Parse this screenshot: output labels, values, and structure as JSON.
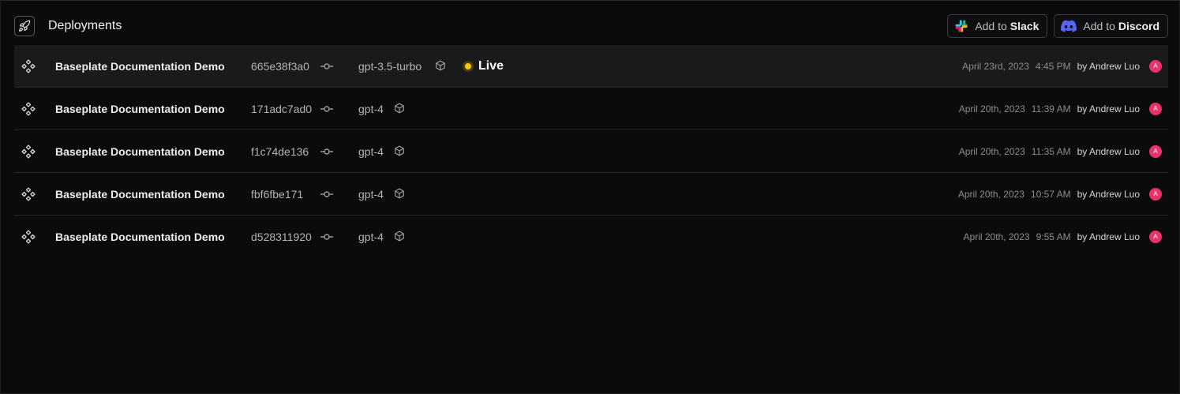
{
  "header": {
    "title": "Deployments",
    "slack_prefix": "Add to",
    "slack_name": "Slack",
    "discord_prefix": "Add to",
    "discord_name": "Discord"
  },
  "colors": {
    "background": "#0b0b0c",
    "row_highlight": "#1a1a1c",
    "live_dot": "#f5c518",
    "avatar": "#e6336b",
    "discord": "#5865f2"
  },
  "deployments": [
    {
      "name": "Baseplate Documentation Demo",
      "hash": "665e38f3a0",
      "model": "gpt-3.5-turbo",
      "status": "Live",
      "date": "April 23rd, 2023",
      "time": "4:45 PM",
      "author": "by Andrew Luo",
      "avatar_initial": "A"
    },
    {
      "name": "Baseplate Documentation Demo",
      "hash": "171adc7ad0",
      "model": "gpt-4",
      "status": "",
      "date": "April 20th, 2023",
      "time": "11:39 AM",
      "author": "by Andrew Luo",
      "avatar_initial": "A"
    },
    {
      "name": "Baseplate Documentation Demo",
      "hash": "f1c74de136",
      "model": "gpt-4",
      "status": "",
      "date": "April 20th, 2023",
      "time": "11:35 AM",
      "author": "by Andrew Luo",
      "avatar_initial": "A"
    },
    {
      "name": "Baseplate Documentation Demo",
      "hash": "fbf6fbe171",
      "model": "gpt-4",
      "status": "",
      "date": "April 20th, 2023",
      "time": "10:57 AM",
      "author": "by Andrew Luo",
      "avatar_initial": "A"
    },
    {
      "name": "Baseplate Documentation Demo",
      "hash": "d528311920",
      "model": "gpt-4",
      "status": "",
      "date": "April 20th, 2023",
      "time": "9:55 AM",
      "author": "by Andrew Luo",
      "avatar_initial": "A"
    }
  ]
}
